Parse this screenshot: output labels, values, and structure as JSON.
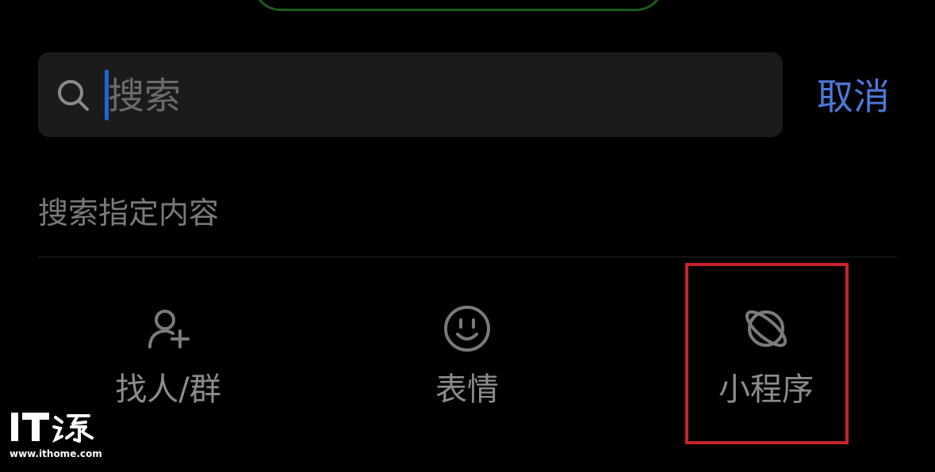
{
  "search": {
    "placeholder": "搜索",
    "cancel_label": "取消"
  },
  "section": {
    "title": "搜索指定内容"
  },
  "options": [
    {
      "label": "找人/群",
      "icon": "add-person-icon"
    },
    {
      "label": "表情",
      "icon": "smiley-face-icon"
    },
    {
      "label": "小程序",
      "icon": "planet-icon"
    }
  ],
  "watermark": {
    "logo_text": "IT之家",
    "url": "www.ithome.com"
  },
  "colors": {
    "background": "#000000",
    "search_box": "#1b1b1b",
    "accent_blue": "#4d78d8",
    "caret": "#1f66d6",
    "text_muted": "#8c8c8c",
    "highlight_red": "#c8222b"
  }
}
